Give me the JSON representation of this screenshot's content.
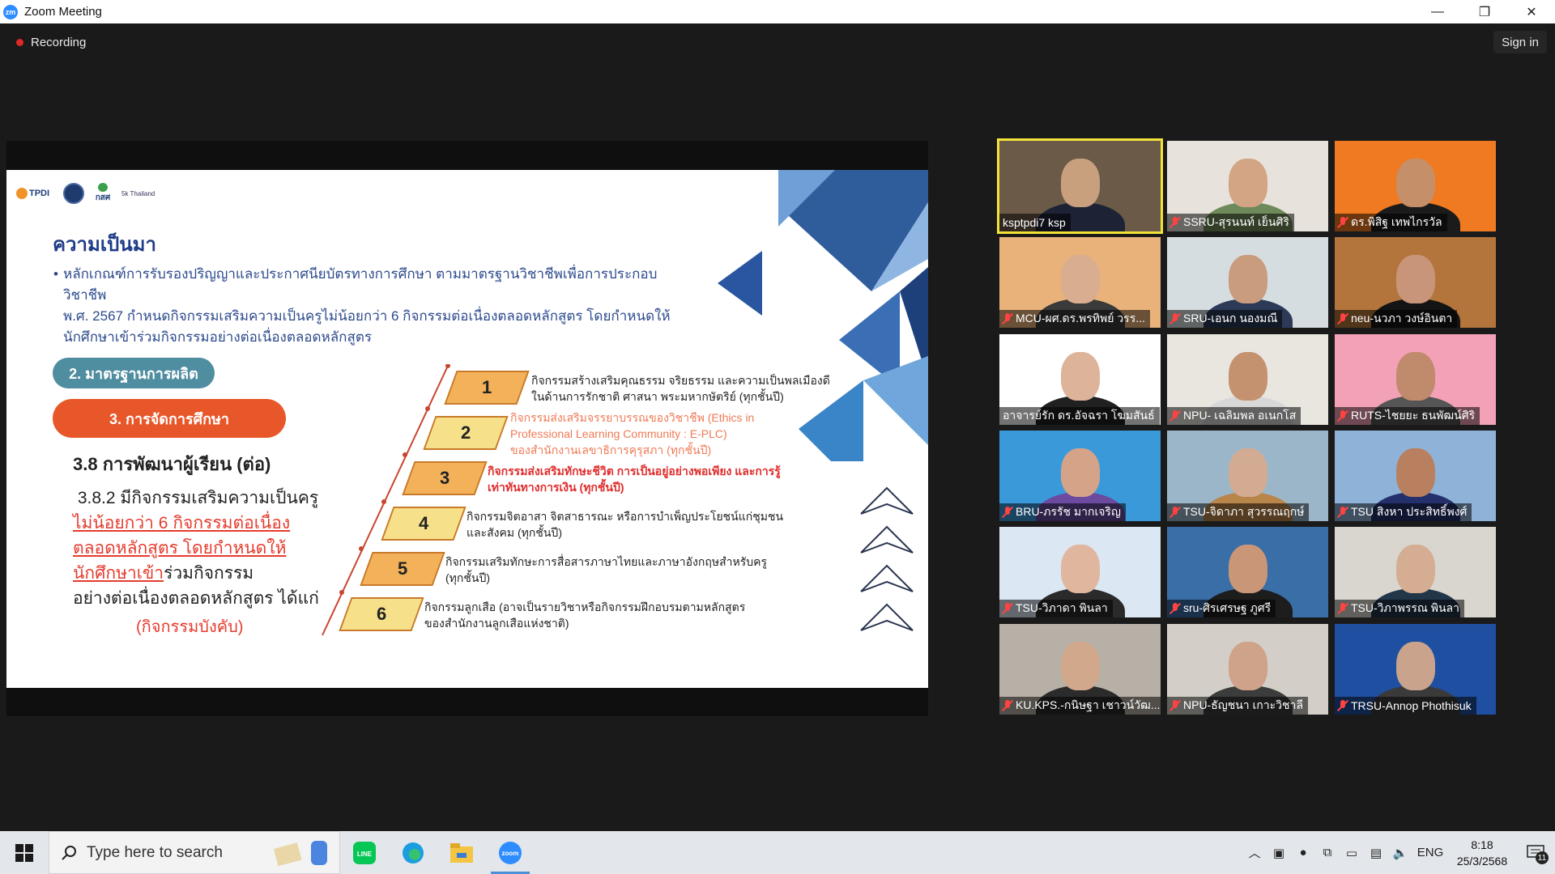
{
  "window": {
    "title": "Zoom Meeting",
    "minimize": "—",
    "restore": "❐",
    "close": "✕"
  },
  "meeting": {
    "recording_label": "Recording",
    "signin_label": "Sign in"
  },
  "slide": {
    "logos": [
      "TPDI",
      "คุรุสภา",
      "กสศ",
      "5k Thailand"
    ],
    "heading": "ความเป็นมา",
    "bullet_lines": [
      "หลักเกณฑ์การรับรองปริญญาและประกาศนียบัตรทางการศึกษา ตามมาตรฐานวิชาชีพเพื่อการประกอบวิชาชีพ",
      "พ.ศ. 2567 กำหนดกิจกรรมเสริมความเป็นครูไม่น้อยกว่า 6 กิจกรรมต่อเนื่องตลอดหลักสูตร โดยกำหนดให้",
      "นักศึกษาเข้าร่วมกิจกรรมอย่างต่อเนื่องตลอดหลักสูตร"
    ],
    "button_2": "2. มาตรฐานการผลิต",
    "button_3": "3. การจัดการศึกษา",
    "section_38": "3.8 การพัฒนาผู้เรียน (ต่อ)",
    "s382_line1": "3.8.2 มีกิจกรรมเสริมความเป็นครู",
    "s382_red1": "ไม่น้อยกว่า 6 กิจกรรมต่อเนื่อง",
    "s382_red2": "ตลอดหลักสูตร โดยกำหนดให้",
    "s382_red3": "นักศึกษาเข้า",
    "s382_line4_rest": "ร่วมกิจกรรม",
    "s382_line5": "อย่างต่อเนื่องตลอดหลักสูตร ได้แก่",
    "mandatory": "(กิจกรรมบังคับ)",
    "steps": [
      {
        "num": "1",
        "line1": "กิจกรรมสร้างเสริมคุณธรรม จริยธรรม และความเป็นพลเมืองดี",
        "line2": "ในด้านการรักชาติ ศาสนา พระมหากษัตริย์ (ทุกชั้นปี)",
        "line3": "",
        "color": "#f3b25a",
        "text_color": "#222222"
      },
      {
        "num": "2",
        "line1": "กิจกรรมส่งเสริมจรรยาบรรณของวิชาชีพ (Ethics in",
        "line2": "Professional Learning Community : E-PLC)",
        "line3": "ของสำนักงานเลขาธิการคุรุสภา (ทุกชั้นปี)",
        "color": "#f6e08a",
        "text_color": "#ef7a55"
      },
      {
        "num": "3",
        "line1": "กิจกรรมส่งเสริมทักษะชีวิต การเป็นอยู่อย่างพอเพียง และการรู้",
        "line2": "เท่าทันทางการเงิน (ทุกชั้นปี)",
        "line3": "",
        "color": "#f3b25a",
        "text_color": "#e02d2d"
      },
      {
        "num": "4",
        "line1": "กิจกรรมจิตอาสา จิตสาธารณะ หรือการบำเพ็ญประโยชน์แก่ชุมชน",
        "line2": "และสังคม (ทุกชั้นปี)",
        "line3": "",
        "color": "#f6e08a",
        "text_color": "#222222"
      },
      {
        "num": "5",
        "line1": "กิจกรรมเสริมทักษะการสื่อสารภาษาไทยและภาษาอังกฤษสำหรับครู",
        "line2": "(ทุกชั้นปี)",
        "line3": "",
        "color": "#f3b25a",
        "text_color": "#222222"
      },
      {
        "num": "6",
        "line1": "กิจกรรมลูกเสือ (อาจเป็นรายวิชาหรือกิจกรรมฝึกอบรมตามหลักสูตร",
        "line2": "ของสำนักงานลูกเสือแห่งชาติ)",
        "line3": "",
        "color": "#f6e08a",
        "text_color": "#222222"
      }
    ]
  },
  "participants": [
    {
      "name": "ksptpdi7 ksp",
      "muted": false,
      "active": true,
      "bg": "#6b5a48",
      "face": "#c9a07e",
      "body": "#1d2235"
    },
    {
      "name": "SSRU-สุรนนท์ เย็นศิริ",
      "muted": true,
      "active": false,
      "bg": "#e7e3dc",
      "face": "#d3a585",
      "body": "#6f8a5a"
    },
    {
      "name": "ดร.พิสิฐ เทพไกรวัล",
      "muted": true,
      "active": false,
      "bg": "#f07a21",
      "face": "#c58f6a",
      "body": "#1b1b1b"
    },
    {
      "name": "MCU-ผศ.ดร.พรทิพย์ วรร...",
      "muted": true,
      "active": false,
      "bg": "#e9b27a",
      "face": "#d9ad8f",
      "body": "#3a3a3a"
    },
    {
      "name": "SRU-เอนก นองมณี",
      "muted": true,
      "active": false,
      "bg": "#d6dde1",
      "face": "#c99c7d",
      "body": "#2c3a58"
    },
    {
      "name": "neu-นวภา วงษ์อินตา",
      "muted": true,
      "active": false,
      "bg": "#b3753b",
      "face": "#c9957a",
      "body": "#141414"
    },
    {
      "name": "อาจารย์รัก ดร.อัจฉรา โฆมสันธ์",
      "muted": false,
      "active": false,
      "bg": "#ffffff",
      "face": "#ddb39a",
      "body": "#202020"
    },
    {
      "name": "NPU- เฉลิมพล อเนกโส",
      "muted": true,
      "active": false,
      "bg": "#e9e6e0",
      "face": "#c4926f",
      "body": "#d8d8d8"
    },
    {
      "name": "RUTS-ไชยยะ ธนพัฒน์ศิริ",
      "muted": true,
      "active": false,
      "bg": "#f3a1b7",
      "face": "#c08a6c",
      "body": "#555555"
    },
    {
      "name": "BRU-ภรรัช มากเจริญ",
      "muted": true,
      "active": false,
      "bg": "#3a9ad9",
      "face": "#d5a488",
      "body": "#6b4aa0"
    },
    {
      "name": "TSU-จิดาภา สุวรรณฤกษ์",
      "muted": true,
      "active": false,
      "bg": "#9cb6c9",
      "face": "#d3ab92",
      "body": "#b8864a"
    },
    {
      "name": "TSU สิงหา ประสิทธิ์พงศ์",
      "muted": true,
      "active": false,
      "bg": "#8fb2d8",
      "face": "#b8805e",
      "body": "#24306b"
    },
    {
      "name": "TSU-วิภาดา พินลา",
      "muted": true,
      "active": false,
      "bg": "#dbe7f3",
      "face": "#e0b79e",
      "body": "#2a2a2a"
    },
    {
      "name": "sru-ศิรเศรษฐ ภูศรี",
      "muted": true,
      "active": false,
      "bg": "#3a6ea7",
      "face": "#c99677",
      "body": "#1d1d1d"
    },
    {
      "name": "TSU-วิภาพรรณ พินลา",
      "muted": true,
      "active": false,
      "bg": "#d9d6cf",
      "face": "#d5ad93",
      "body": "#22364a"
    },
    {
      "name": "KU.KPS.-กนิษฐา เชาวน์วัฒ...",
      "muted": true,
      "active": false,
      "bg": "#b7b0a6",
      "face": "#d2a88d",
      "body": "#2b2b2b"
    },
    {
      "name": "NPU-ธัญชนา เกาะวิชาลี",
      "muted": true,
      "active": false,
      "bg": "#d3cfc8",
      "face": "#cfa28a",
      "body": "#3c3c3c"
    },
    {
      "name": "TRSU-Annop Phothisuk",
      "muted": true,
      "active": false,
      "bg": "#1f4fa0",
      "face": "#c9a38c",
      "body": "#3a3a3a"
    }
  ],
  "taskbar": {
    "search_placeholder": "Type here to search",
    "apps": [
      "paint-app-icon",
      "line-app-icon",
      "edge-app-icon",
      "file-explorer-icon",
      "zoom-app-icon"
    ],
    "language": "ENG",
    "time": "8:18",
    "date": "25/3/2568",
    "notification_count": "11"
  }
}
